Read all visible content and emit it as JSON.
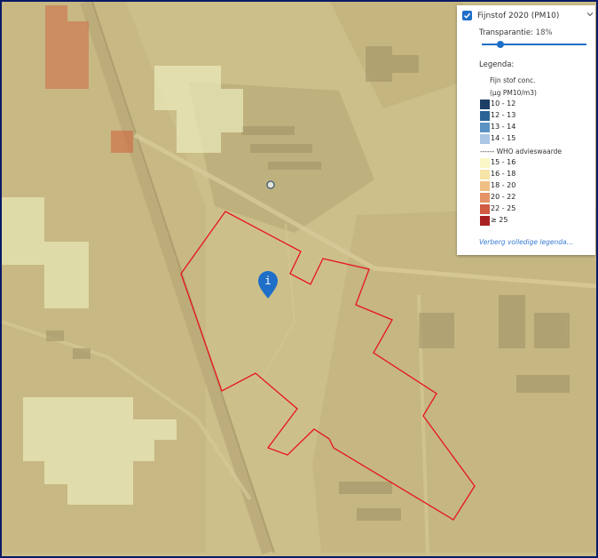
{
  "layer": {
    "title": "Fijnstof 2020 (PM10)",
    "checked": true,
    "transparency_label": "Transparantie:",
    "transparency_value": "18%",
    "transparency_fraction": 0.18
  },
  "legend": {
    "title": "Legenda:",
    "subtitle_line1": "Fijn stof conc.",
    "subtitle_line2": "(μg PM10/m3)",
    "items_blue": [
      {
        "label": "10 - 12",
        "color": "#1d3f66"
      },
      {
        "label": "12 - 13",
        "color": "#2a6496"
      },
      {
        "label": "13 - 14",
        "color": "#5b93c4"
      },
      {
        "label": "14 - 15",
        "color": "#a9c6e4"
      }
    ],
    "who_label": "------ WHO advieswaarde",
    "items_warm": [
      {
        "label": "15 - 16",
        "color": "#fbf7c6"
      },
      {
        "label": "16 - 18",
        "color": "#f7e4a6"
      },
      {
        "label": "18 - 20",
        "color": "#efbf85"
      },
      {
        "label": "20 - 22",
        "color": "#e49366"
      },
      {
        "label": "22 - 25",
        "color": "#d05a42"
      },
      {
        "label": "≥ 25",
        "color": "#a82020"
      }
    ],
    "hide_link": "Verberg volledige legenda..."
  },
  "colors": {
    "frame_border": "#0a1a66",
    "boundary": "#e8141e",
    "marker": "#1f6fc8",
    "accent": "#1f6fc8",
    "base_overlay": "#e8d99a"
  },
  "icons": {
    "info_marker": "info-pin-icon",
    "location": "location-circle-icon",
    "checkbox": "checkmark-icon",
    "chevron": "chevron-down-icon"
  }
}
